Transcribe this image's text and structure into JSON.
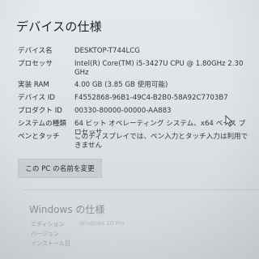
{
  "page": {
    "title": "デバイスの仕様"
  },
  "specs": [
    {
      "label": "デバイス名",
      "value": "DESKTOP-T744LCG"
    },
    {
      "label": "プロセッサ",
      "value": "Intel(R) Core(TM) i5-3427U CPU @ 1.80GHz   2.30 GHz"
    },
    {
      "label": "実装 RAM",
      "value": "4.00 GB (3.85 GB 使用可能)"
    },
    {
      "label": "デバイス ID",
      "value": "F4552868-96B1-49C4-B2B0-58A92C7703B7"
    },
    {
      "label": "プロダクト ID",
      "value": "00330-80000-00000-AA883"
    },
    {
      "label": "システムの種類",
      "value": "64 ビット オペレーティング システム、x64 ベース プロセッサ"
    },
    {
      "label": "ペンとタッチ",
      "value": "このディスプレイでは、ペン入力とタッチ入力は利用できません"
    }
  ],
  "rename_button": {
    "label": "この PC の名前を変更"
  },
  "windows_section": {
    "title": "Windows の仕様",
    "rows": [
      {
        "label": "エディション",
        "value": "Windows 10 Pro"
      },
      {
        "label": "バージョン",
        "value": ""
      },
      {
        "label": "インストール日",
        "value": ""
      }
    ]
  },
  "icons": {
    "cursor": "mouse-pointer-icon"
  },
  "colors": {
    "background": "#dde2e4",
    "text": "#2b2f33",
    "button": "#c9ced1"
  }
}
